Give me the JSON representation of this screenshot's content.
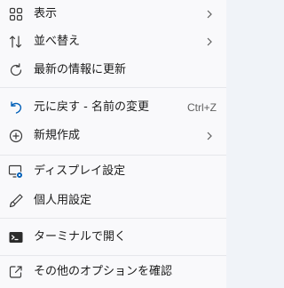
{
  "menu": {
    "items": [
      {
        "label": "表示",
        "icon": "grid-view-icon"
      },
      {
        "label": "並べ替え",
        "icon": "sort-arrows-icon"
      },
      {
        "label": "最新の情報に更新",
        "icon": "refresh-icon"
      },
      {
        "label": "元に戻す - 名前の変更",
        "shortcut": "Ctrl+Z",
        "icon": "undo-icon"
      },
      {
        "label": "新規作成",
        "icon": "new-plus-icon"
      },
      {
        "label": "ディスプレイ設定",
        "icon": "display-settings-icon"
      },
      {
        "label": "個人用設定",
        "icon": "personalize-brush-icon"
      },
      {
        "label": "ターミナルで開く",
        "icon": "terminal-icon"
      },
      {
        "label": "その他のオプションを確認",
        "icon": "more-options-icon"
      }
    ]
  },
  "colors": {
    "text": "#1b1b1b",
    "accent": "#005fb8",
    "separator": "#e6e7eb",
    "background": "#f9f9fb"
  }
}
